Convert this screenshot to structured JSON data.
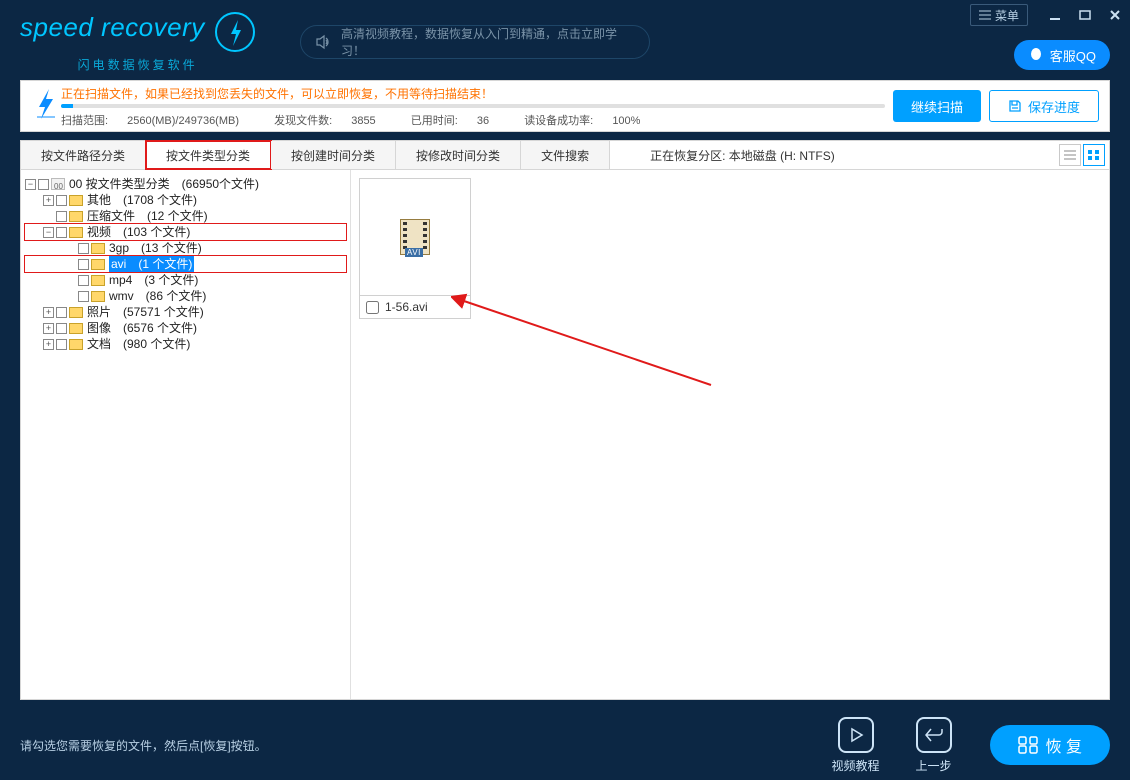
{
  "app": {
    "logo_text": "speed recovery",
    "logo_sub": "闪电数据恢复软件",
    "menu_label": "菜单",
    "qq_label": "客服QQ",
    "tutorial_text": "高清视频教程，数据恢复从入门到精通，点击立即学习！"
  },
  "scan": {
    "message": "正在扫描文件，如果已经找到您丢失的文件，可以立即恢复，不用等待扫描结束！",
    "range_label": "扫描范围:",
    "range_value": "2560(MB)/249736(MB)",
    "found_label": "发现文件数:",
    "found_value": "3855",
    "time_label": "已用时间:",
    "time_value": "36",
    "rate_label": "读设备成功率:",
    "rate_value": "100%",
    "continue_btn": "继续扫描",
    "save_btn": "保存进度"
  },
  "tabs": {
    "by_path": "按文件路径分类",
    "by_type": "按文件类型分类",
    "by_create": "按创建时间分类",
    "by_modify": "按修改时间分类",
    "search": "文件搜索",
    "partition_label": "正在恢复分区: 本地磁盘 (H: NTFS)"
  },
  "tree": {
    "root": "00 按文件类型分类　(66950个文件)",
    "other": "其他　(1708 个文件)",
    "archive": "压缩文件　(12 个文件)",
    "video": "视频　(103 个文件)",
    "v_3gp": "3gp　(13 个文件)",
    "v_avi": "avi　(1 个文件)",
    "v_mp4": "mp4　(3 个文件)",
    "v_wmv": "wmv　(86 个文件)",
    "photo": "照片　(57571 个文件)",
    "image": "图像　(6576 个文件)",
    "doc": "文档　(980 个文件)"
  },
  "file": {
    "name": "1-56.avi",
    "icon_label": "AVI"
  },
  "footer": {
    "hint": "请勾选您需要恢复的文件，然后点[恢复]按钮。",
    "tutorial": "视频教程",
    "prev": "上一步",
    "recover": "恢 复"
  }
}
